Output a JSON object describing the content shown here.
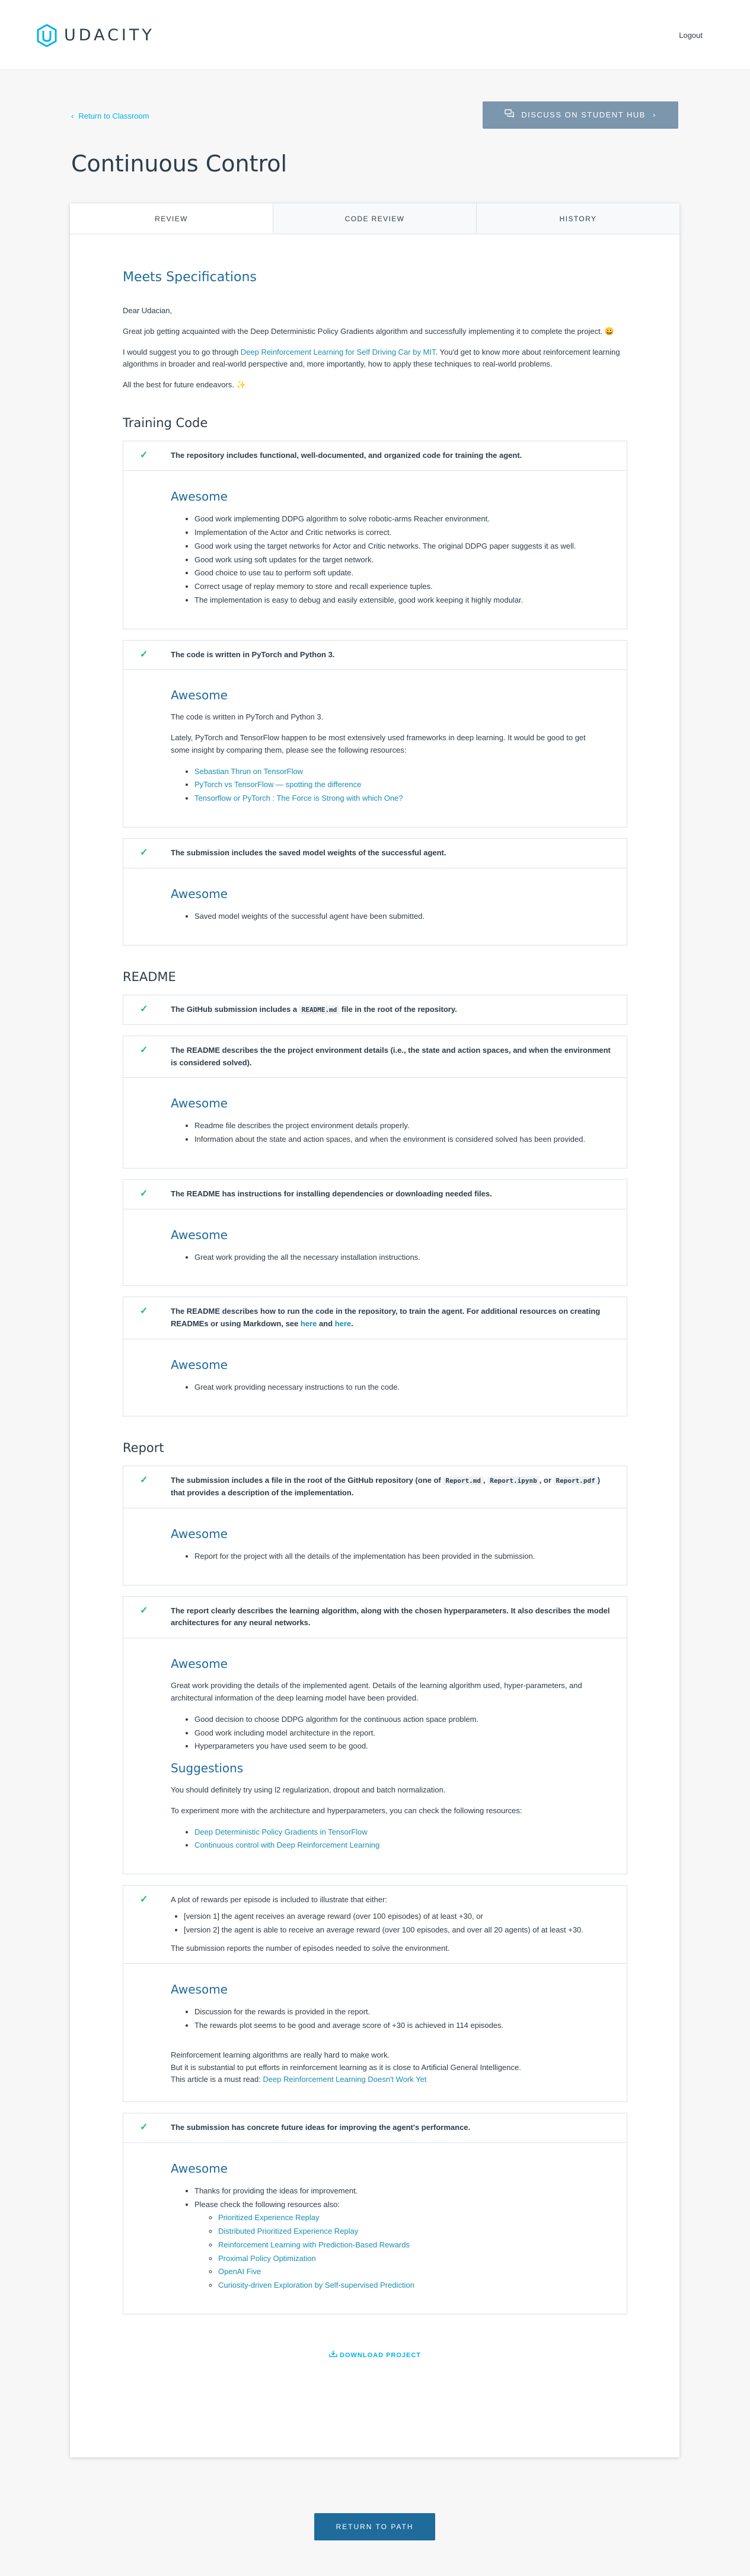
{
  "header": {
    "logo_text": "UDACITY",
    "logout": "Logout"
  },
  "nav": {
    "return_link": "Return to Classroom",
    "discuss_button": "DISCUSS ON STUDENT HUB"
  },
  "page_title": "Continuous Control",
  "tabs": [
    "REVIEW",
    "CODE REVIEW",
    "HISTORY"
  ],
  "review": {
    "status": "Meets Specifications",
    "greeting": "Dear Udacian,",
    "intro": "Great job getting acquainted with the Deep Deterministic Policy Gradients algorithm and successfully implementing it to complete the project. 😀",
    "suggest_pre": "I would suggest you to go through ",
    "suggest_link": "Deep Reinforcement Learning for Self Driving Car by MIT",
    "suggest_post": ". You'd get to know more about reinforcement learning algorithms in broader and real-world perspective and, more importantly, how to apply these techniques to real-world problems.",
    "closing": "All the best for future endeavors. ✨"
  },
  "sections": {
    "training": "Training Code",
    "readme": "README",
    "report": "Report"
  },
  "awesome_label": "Awesome",
  "suggestions_label": "Suggestions",
  "rubrics": {
    "r1": {
      "head": "The repository includes functional, well-documented, and organized code for training the agent.",
      "items": [
        "Good work implementing DDPG algorithm to solve robotic-arms Reacher environment.",
        "Implementation of the Actor and Critic networks is correct.",
        "Good work using the target networks for Actor and Critic networks. The original DDPG paper suggests it as well.",
        "Good work using soft updates for the target network.",
        "Good choice to use tau to perform soft update.",
        "Correct usage of replay memory to store and recall experience tuples.",
        "The implementation is easy to debug and easily extensible, good work keeping it highly modular."
      ]
    },
    "r2": {
      "head": "The code is written in PyTorch and Python 3.",
      "p1": "The code is written in PyTorch and Python 3.",
      "p2": "Lately, PyTorch and TensorFlow happen to be most extensively used frameworks in deep learning. It would be good to get some insight by comparing them, please see the following resources:",
      "links": [
        "Sebastian Thrun on TensorFlow",
        "PyTorch vs TensorFlow — spotting the difference",
        "Tensorflow or PyTorch : The Force is Strong with which One?"
      ]
    },
    "r3": {
      "head": "The submission includes the saved model weights of the successful agent.",
      "items": [
        "Saved model weights of the successful agent have been submitted."
      ]
    },
    "r4": {
      "head_pre": "The GitHub submission includes a ",
      "head_code": "README.md",
      "head_post": " file in the root of the repository."
    },
    "r5": {
      "head": "The README describes the the project environment details (i.e., the state and action spaces, and when the environment is considered solved).",
      "items": [
        "Readme file describes the project environment details properly.",
        "Information about the state and action spaces, and when the environment is considered solved has been provided."
      ]
    },
    "r6": {
      "head": "The README has instructions for installing dependencies or downloading needed files.",
      "items": [
        "Great work providing the all the necessary installation instructions."
      ]
    },
    "r7": {
      "head_pre": "The README describes how to run the code in the repository, to train the agent. For additional resources on creating READMEs or using Markdown, see ",
      "head_link1": "here",
      "head_mid": " and ",
      "head_link2": "here",
      "head_post": ".",
      "items": [
        "Great work providing necessary instructions to run the code."
      ]
    },
    "r8": {
      "head_pre": "The submission includes a file in the root of the GitHub repository (one of ",
      "code1": "Report.md",
      "sep1": ", ",
      "code2": "Report.ipynb",
      "sep2": ", or ",
      "code3": "Report.pdf",
      "head_post": ") that provides a description of the implementation.",
      "items": [
        "Report for the project with all the details of the implementation has been provided in the submission."
      ]
    },
    "r9": {
      "head": "The report clearly describes the learning algorithm, along with the chosen hyperparameters. It also describes the model architectures for any neural networks.",
      "p1": "Great work providing the details of the implemented agent. Details of the learning algorithm used, hyper-parameters, and architectural information of the deep learning model have been provided.",
      "items": [
        "Good decision to choose DDPG algorithm for the continuous action space problem.",
        "Good work including model architecture in the report.",
        "Hyperparameters you have used seem to be good."
      ],
      "s1": "You should definitely try using l2 regularization, dropout and batch normalization.",
      "s2": "To experiment more with the architecture and hyperparameters, you can check the following resources:",
      "links": [
        "Deep Deterministic Policy Gradients in TensorFlow",
        "Continuous control with Deep Reinforcement Learning"
      ]
    },
    "r10": {
      "head": "A plot of rewards per episode is included to illustrate that either:",
      "v1": "[version 1] the agent receives an average reward (over 100 episodes) of at least +30, or",
      "v2": "[version 2] the agent is able to receive an average reward (over 100 episodes, and over all 20 agents) of at least +30.",
      "head2": "The submission reports the number of episodes needed to solve the environment.",
      "items": [
        "Discussion for the rewards is provided in the report.",
        "The rewards plot seems to be good and average score of +30 is achieved in 114 episodes."
      ],
      "p1": "Reinforcement learning algorithms are really hard to make work.",
      "p2": "But it is substantial to put efforts in reinforcement learning as it is close to Artificial General Intelligence.",
      "p3_pre": "This article is a must read: ",
      "p3_link": "Deep Reinforcement Learning Doesn't Work Yet"
    },
    "r11": {
      "head": "The submission has concrete future ideas for improving the agent's performance.",
      "items": [
        "Thanks for providing the ideas for improvement.",
        "Please check the following resources also:"
      ],
      "links": [
        "Prioritized Experience Replay",
        "Distributed Prioritized Experience Replay",
        "Reinforcement Learning with Prediction-Based Rewards",
        "Proximal Policy Optimization",
        "OpenAI Five",
        "Curiosity-driven Exploration by Self-supervised Prediction"
      ]
    }
  },
  "download": "DOWNLOAD PROJECT",
  "return_to_path": "RETURN TO PATH"
}
